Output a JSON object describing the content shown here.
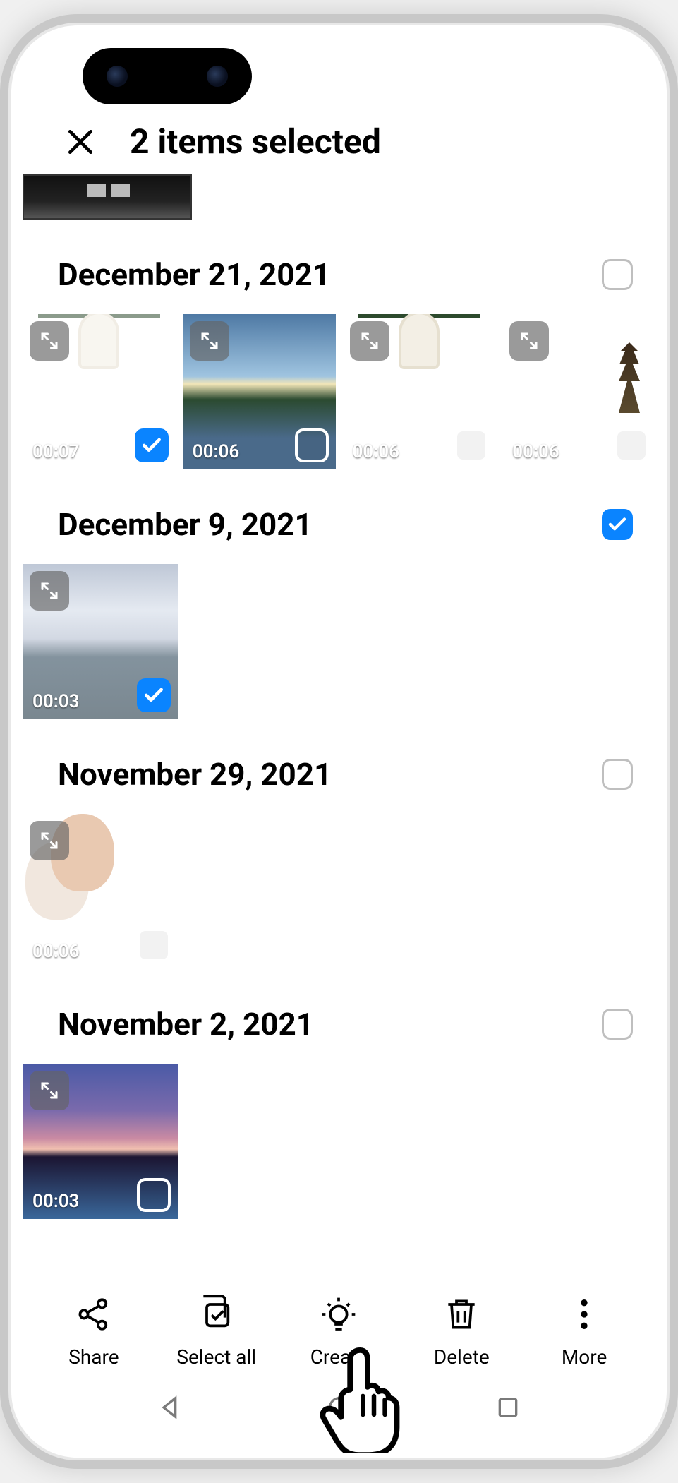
{
  "header": {
    "title": "2 items selected"
  },
  "groups": [
    {
      "date": "December 21, 2021",
      "all_checked": false,
      "items": [
        {
          "duration": "00:07",
          "checked": true,
          "img": "taj"
        },
        {
          "duration": "00:06",
          "checked": false,
          "img": "lake"
        },
        {
          "duration": "00:06",
          "checked": false,
          "img": "taj"
        },
        {
          "duration": "00:06",
          "checked": false,
          "img": "pagoda"
        }
      ]
    },
    {
      "date": "December 9, 2021",
      "all_checked": true,
      "items": [
        {
          "duration": "00:03",
          "checked": true,
          "img": "ocean"
        }
      ]
    },
    {
      "date": "November 29, 2021",
      "all_checked": false,
      "items": [
        {
          "duration": "00:06",
          "checked": false,
          "img": "person"
        }
      ]
    },
    {
      "date": "November 2, 2021",
      "all_checked": false,
      "items": [
        {
          "duration": "00:03",
          "checked": false,
          "img": "sunset"
        }
      ]
    }
  ],
  "toolbar": {
    "share": "Share",
    "select_all": "Select all",
    "create": "Create",
    "delete": "Delete",
    "more": "More"
  }
}
